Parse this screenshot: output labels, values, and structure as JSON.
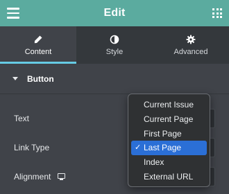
{
  "header": {
    "title": "Edit",
    "left_icon": "hamburger-menu-icon",
    "right_icon": "grid-icon",
    "accent": "#5bab9f"
  },
  "tabs": [
    {
      "label": "Content",
      "icon": "pencil-icon",
      "active": true
    },
    {
      "label": "Style",
      "icon": "contrast-icon",
      "active": false
    },
    {
      "label": "Advanced",
      "icon": "gear-icon",
      "active": false
    }
  ],
  "section": {
    "title": "Button"
  },
  "fields": {
    "text_label": "Text",
    "link_type_label": "Link Type",
    "alignment_label": "Alignment"
  },
  "dropdown": {
    "options": [
      "Current Issue",
      "Current Page",
      "First Page",
      "Last Page",
      "Index",
      "External URL"
    ],
    "selected": "Last Page",
    "check_glyph": "✓",
    "selection_color": "#2b6fd6"
  }
}
